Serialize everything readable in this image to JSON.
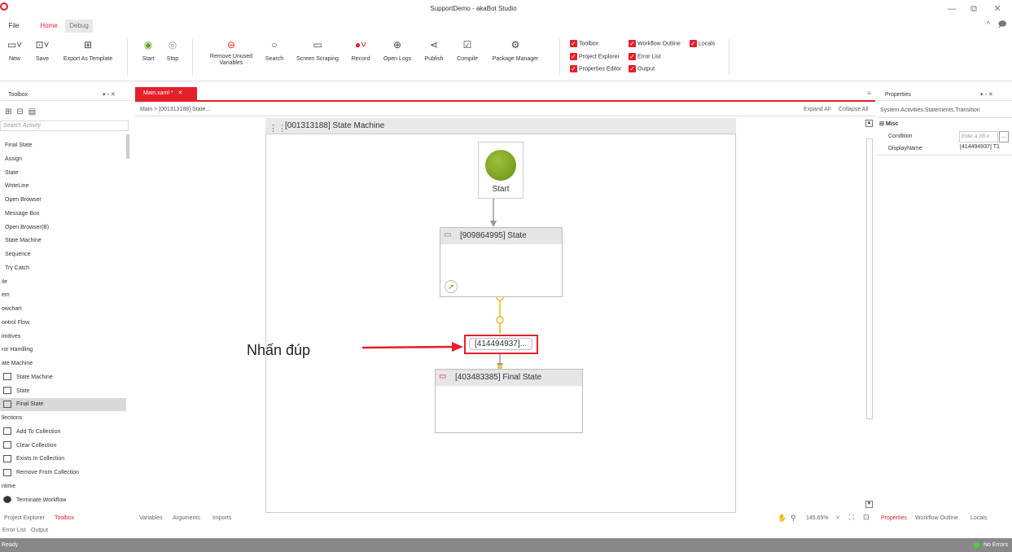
{
  "window": {
    "title": "SupportDemo - akaBot Studio",
    "minimize": "—",
    "maximize": "⧉",
    "close": "✕",
    "collapse": "^",
    "comment": "🗩"
  },
  "menu": {
    "file": "File",
    "home": "Home",
    "debug": "Debug"
  },
  "ribbon": {
    "buttons": [
      {
        "label": "New",
        "icon": "▭˅"
      },
      {
        "label": "Save",
        "icon": "⊡˅"
      },
      {
        "label": "Export As Template",
        "icon": "⊞"
      },
      {
        "label": "Start",
        "icon": "◉"
      },
      {
        "label": "Stop",
        "icon": "◎"
      },
      {
        "label": "Remove Unused\nVariables",
        "icon": "⊖"
      },
      {
        "label": "Search",
        "icon": "○"
      },
      {
        "label": "Screen Scraping",
        "icon": "▭"
      },
      {
        "label": "Record",
        "icon": "●˅"
      },
      {
        "label": "Open Logs",
        "icon": "⊕"
      },
      {
        "label": "Publish",
        "icon": "⋖"
      },
      {
        "label": "Compile",
        "icon": "☑"
      },
      {
        "label": "Package Manager",
        "icon": "⚙"
      }
    ],
    "checks": [
      {
        "label": "Toolbox"
      },
      {
        "label": "Workflow Outline"
      },
      {
        "label": "Locals"
      },
      {
        "label": "Project Explorer"
      },
      {
        "label": "Error List"
      },
      {
        "label": "Properties Editor"
      },
      {
        "label": "Output"
      }
    ]
  },
  "toolbox": {
    "title": "Toolbox",
    "pin": "▾ ▫ ✕",
    "search_placeholder": "Search Activity",
    "items": [
      "Final State",
      "Assign",
      "State",
      "WriteLine",
      "Open Browser",
      "Message Box",
      "Open Browser(B)",
      "State Machine",
      "Sequence",
      "Try Catch",
      "ile",
      "em",
      "owchart",
      "ontrol Flow",
      "imitives",
      "ror Handling",
      "ate Machine"
    ],
    "state_items": [
      "State Machine",
      "State",
      "Final State"
    ],
    "categories": [
      "llections",
      "ntime"
    ],
    "collection_items": [
      "Add To Collection",
      "Clear Collection",
      "Exists In Collection",
      "Remove From Collection"
    ],
    "runtime_items": [
      "Terminate Workflow"
    ],
    "bottom_tabs": [
      "Project Explorer",
      "Toolbox"
    ],
    "bottom_tabs2": [
      "Error List",
      "Output"
    ]
  },
  "document": {
    "tab": "Main.xaml *",
    "tab_close": "✕",
    "breadcrumb": "Main > [001313188] State...",
    "expand_all": "Expand All",
    "collapse_all": "Collapse All",
    "machine_title": "[001313188] State Machine",
    "start_label": "Start",
    "state1": "[909864995] State",
    "transition": "[414494937]...",
    "final_state": "[403483385] Final State",
    "annotation": "Nhấn đúp",
    "bottom_tabs": [
      "Variables",
      "Arguments",
      "Imports"
    ],
    "zoom": "145.65%"
  },
  "properties": {
    "title": "Properties",
    "pin": "▾ ▫ ✕",
    "type": "System.Activities.Statements.Transition",
    "category": "Misc",
    "rows": [
      {
        "name": "Condition",
        "value": "Enter a VB e"
      },
      {
        "name": "DisplayName",
        "value": "[414494937] T1"
      }
    ],
    "bottom_tabs": [
      "Properties",
      "Workflow Outline",
      "Locals"
    ]
  },
  "status": {
    "left": "Ready",
    "right": "No Errors"
  },
  "colors": {
    "accent": "#e4202b",
    "start": "#7aa11b"
  }
}
